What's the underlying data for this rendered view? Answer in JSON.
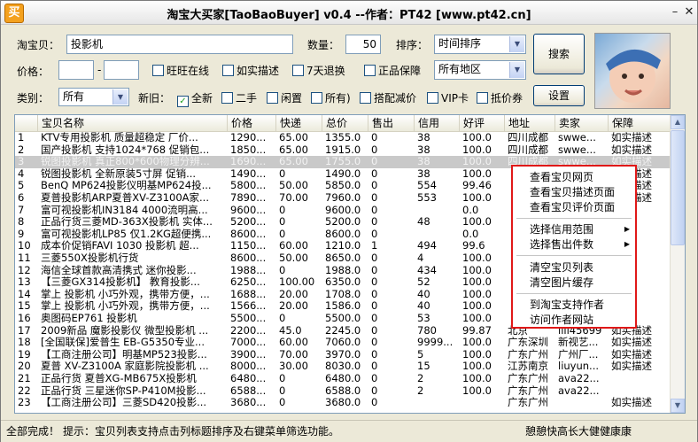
{
  "window": {
    "icon_text": "买",
    "title": "淘宝大买家[TaoBaoBuyer] v0.4 --作者：PT42 [www.pt42.cn]"
  },
  "search": {
    "item_label": "淘宝贝：",
    "item_value": "投影机",
    "qty_label": "数量：",
    "qty_value": "50",
    "sort_label": "排序：",
    "sort_value": "时间排序",
    "price_label": "价格：",
    "price_min": "",
    "price_sep": "-",
    "price_max": "",
    "region_value": "所有地区",
    "category_label": "类别：",
    "category_value": "所有",
    "condition_label": "新旧："
  },
  "checkboxes_row1": [
    {
      "label": "旺旺在线",
      "checked": false
    },
    {
      "label": "如实描述",
      "checked": false
    },
    {
      "label": "7天退换",
      "checked": false
    },
    {
      "label": "正品保障",
      "checked": false
    }
  ],
  "checkboxes_row2": [
    {
      "label": "全新",
      "checked": true
    },
    {
      "label": "二手",
      "checked": false
    },
    {
      "label": "闲置",
      "checked": false
    },
    {
      "label": "所有)",
      "checked": false
    },
    {
      "label": "搭配减价",
      "checked": false
    },
    {
      "label": "VIP卡",
      "checked": false
    },
    {
      "label": "抵价券",
      "checked": false
    }
  ],
  "buttons": {
    "search": "搜索",
    "settings": "设置"
  },
  "table": {
    "columns": [
      "宝贝名称",
      "价格",
      "快递",
      "总价",
      "售出",
      "信用",
      "好评",
      "地址",
      "卖家",
      "保障"
    ],
    "rows": [
      [
        "1",
        "KTV专用投影机 质量超稳定 厂价...",
        "1290...",
        "65.00",
        "1355.0",
        "0",
        "38",
        "100.0",
        "四川成都",
        "swwe...",
        "如实描述"
      ],
      [
        "2",
        "国产投影机 支持1024*768 促销包...",
        "1850...",
        "65.00",
        "1915.0",
        "0",
        "38",
        "100.0",
        "四川成都",
        "swwe...",
        "如实描述"
      ],
      [
        "3",
        "锐图投影机 真正800*600物理分辨...",
        "1690...",
        "65.00",
        "1755.0",
        "0",
        "38",
        "100.0",
        "四川成都",
        "swwe...",
        "如实描述"
      ],
      [
        "4",
        "锐图投影机 全新原装5寸屏 促销...",
        "1490...",
        "0",
        "1490.0",
        "0",
        "38",
        "100.0",
        "",
        "",
        "如实描述"
      ],
      [
        "5",
        "BenQ MP624投影仪明基MP624投...",
        "5800...",
        "50.00",
        "5850.0",
        "0",
        "554",
        "99.46",
        "",
        "",
        "如实描述"
      ],
      [
        "6",
        "夏普投影机ARP夏普XV-Z3100A家...",
        "7890...",
        "70.00",
        "7960.0",
        "0",
        "553",
        "100.0",
        "",
        "",
        "如实描述"
      ],
      [
        "7",
        "富可视投影机IN3184 4000流明高...",
        "9600...",
        "0",
        "9600.0",
        "0",
        "",
        "0.0",
        "",
        "",
        ""
      ],
      [
        "8",
        "正品行货三菱MD-363X投影机 实体...",
        "5200...",
        "0",
        "5200.0",
        "0",
        "48",
        "100.0",
        "",
        "",
        ""
      ],
      [
        "9",
        "富可视投影机LP85 仅1.2KG超便携...",
        "8600...",
        "0",
        "8600.0",
        "0",
        "",
        "0.0",
        "",
        "",
        ""
      ],
      [
        "10",
        "成本价促销FAVI 1030 投影机 超...",
        "1150...",
        "60.00",
        "1210.0",
        "1",
        "494",
        "99.6",
        "",
        "",
        "换"
      ],
      [
        "11",
        "三菱550X投影机行货",
        "8600...",
        "50.00",
        "8650.0",
        "0",
        "4",
        "100.0",
        "",
        "",
        ""
      ],
      [
        "12",
        "海信全球首款高清携式 迷你投影...",
        "1988...",
        "0",
        "1988.0",
        "0",
        "434",
        "100.0",
        "",
        "",
        "换"
      ],
      [
        "13",
        "【三菱GX314投影机】 教育投影...",
        "6250...",
        "100.00",
        "6350.0",
        "0",
        "52",
        "100.0",
        "",
        "",
        ""
      ],
      [
        "14",
        "掌上 投影机 小巧外观，携带方便，...",
        "1688...",
        "20.00",
        "1708.0",
        "0",
        "40",
        "100.0",
        "",
        "",
        ""
      ],
      [
        "15",
        "掌上 投影机 小巧外观，携带方便，...",
        "1566...",
        "20.00",
        "1586.0",
        "0",
        "40",
        "100.0",
        "",
        "",
        ""
      ],
      [
        "16",
        "奥图码EP761 投影机",
        "5500...",
        "0",
        "5500.0",
        "0",
        "53",
        "100.0",
        "",
        "",
        ""
      ],
      [
        "17",
        "2009新品 魔影投影仪 微型投影机 ...",
        "2200...",
        "45.0",
        "2245.0",
        "0",
        "780",
        "99.87",
        "北京",
        "lili45699",
        "如实描述"
      ],
      [
        "18",
        "[全国联保]爱普生 EB-G5350专业...",
        "7000...",
        "60.00",
        "7060.0",
        "0",
        "9999...",
        "100.0",
        "广东深圳",
        "新视艺...",
        "如实描述"
      ],
      [
        "19",
        "【工商注册公司】明基MP523投影...",
        "3900...",
        "70.00",
        "3970.0",
        "0",
        "5",
        "100.0",
        "广东广州",
        "广州厂...",
        "如实描述"
      ],
      [
        "20",
        "夏普 XV-Z3100A 家庭影院投影机 ...",
        "8000...",
        "30.00",
        "8030.0",
        "0",
        "15",
        "100.0",
        "江苏南京",
        "liuyun...",
        "如实描述"
      ],
      [
        "21",
        "正品行货 夏普XG-MB675X投影机",
        "6480...",
        "0",
        "6480.0",
        "0",
        "2",
        "100.0",
        "广东广州",
        "ava22...",
        ""
      ],
      [
        "22",
        "正品行货 三星迷你SP-P410M投影...",
        "6588...",
        "0",
        "6588.0",
        "0",
        "2",
        "100.0",
        "广东广州",
        "ava22...",
        ""
      ],
      [
        "23",
        "【工商注册公司】三菱SD420投影...",
        "3680...",
        "0",
        "3680.0",
        "0",
        "",
        "",
        "广东广州",
        "",
        "如实描述"
      ]
    ]
  },
  "context_menu": {
    "group1": [
      "查看宝贝网页",
      "查看宝贝描述页面",
      "查看宝贝评价页面"
    ],
    "group2": [
      "选择信用范围",
      "选择售出件数"
    ],
    "group3": [
      "清空宝贝列表",
      "清空图片缓存"
    ],
    "group4": [
      "到淘宝支持作者",
      "访问作者网站"
    ]
  },
  "status": {
    "left": "全部完成！",
    "hint": "提示：宝贝列表支持点击列标题排序及右键菜单筛选功能。",
    "right": "憩憩快高长大健健康康"
  },
  "colors": {
    "highlight_border": "#e01818",
    "selected_row": "#c9c9c9"
  },
  "icons": {
    "close": "close-icon",
    "minimize": "minimize-icon",
    "dropdown": "chevron-down-icon",
    "submenu": "chevron-right-icon"
  }
}
